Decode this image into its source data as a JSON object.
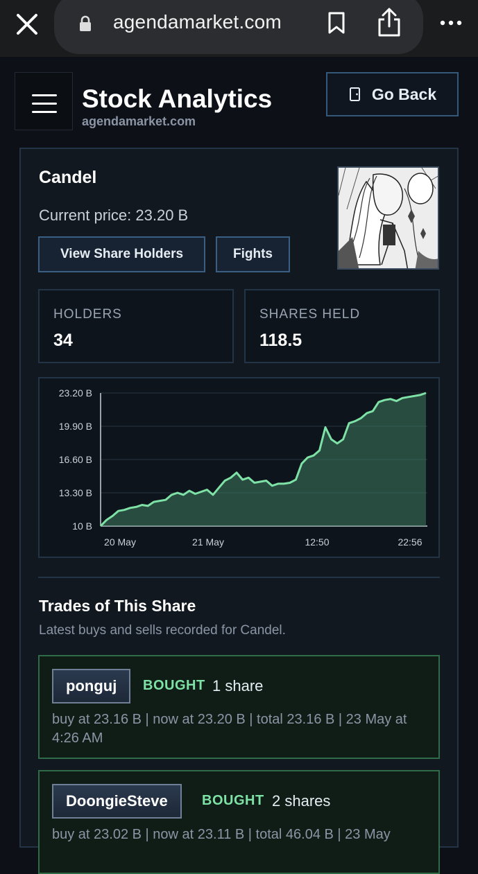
{
  "browser": {
    "url": "agendamarket.com"
  },
  "header": {
    "title": "Stock Analytics",
    "subtitle": "agendamarket.com",
    "go_back_label": "Go Back"
  },
  "share": {
    "name": "Candel",
    "price_text": "Current price: 23.20 B",
    "buttons": {
      "holders": "View Share Holders",
      "fights": "Fights"
    },
    "stats": [
      {
        "label": "HOLDERS",
        "value": "34"
      },
      {
        "label": "SHARES HELD",
        "value": "118.5"
      }
    ]
  },
  "chart_data": {
    "type": "area",
    "y_ticks": [
      "10 B",
      "13.30 B",
      "16.60 B",
      "19.90 B",
      "23.20 B"
    ],
    "x_ticks": [
      "20 May",
      "21 May",
      "12:50",
      "22:56"
    ],
    "ylim": [
      10,
      23.2
    ],
    "grid": true,
    "color": "#3e7a5f",
    "line_color": "#7ee2a6",
    "values": [
      10.0,
      10.6,
      11.0,
      11.5,
      11.6,
      11.8,
      11.9,
      12.1,
      12.0,
      12.4,
      12.5,
      12.6,
      13.1,
      13.3,
      13.1,
      13.5,
      13.2,
      13.4,
      13.6,
      13.1,
      13.8,
      14.5,
      14.8,
      15.3,
      14.6,
      14.8,
      14.3,
      14.4,
      14.5,
      14.0,
      14.2,
      14.2,
      14.3,
      14.6,
      16.2,
      16.8,
      17.0,
      17.5,
      19.8,
      18.6,
      18.2,
      18.6,
      20.2,
      20.4,
      20.7,
      21.2,
      21.4,
      22.3,
      22.5,
      22.6,
      22.4,
      22.7,
      22.8,
      22.9,
      23.0,
      23.2
    ]
  },
  "trades": {
    "title": "Trades of This Share",
    "subtitle": "Latest buys and sells recorded for Candel.",
    "items": [
      {
        "user": "ponguj",
        "action": "BOUGHT",
        "qty": "1 share",
        "detail": "buy at 23.16 B | now at 23.20 B | total 23.16 B | 23 May at 4:26 AM"
      },
      {
        "user": "DoongieSteve",
        "action": "BOUGHT",
        "qty": "2 shares",
        "detail": "buy at 23.02 B | now at 23.11 B | total 46.04 B | 23 May"
      }
    ]
  },
  "icons": [
    "close-icon",
    "lock-icon",
    "bookmark-icon",
    "share-icon",
    "more-icon",
    "menu-icon",
    "door-icon"
  ]
}
